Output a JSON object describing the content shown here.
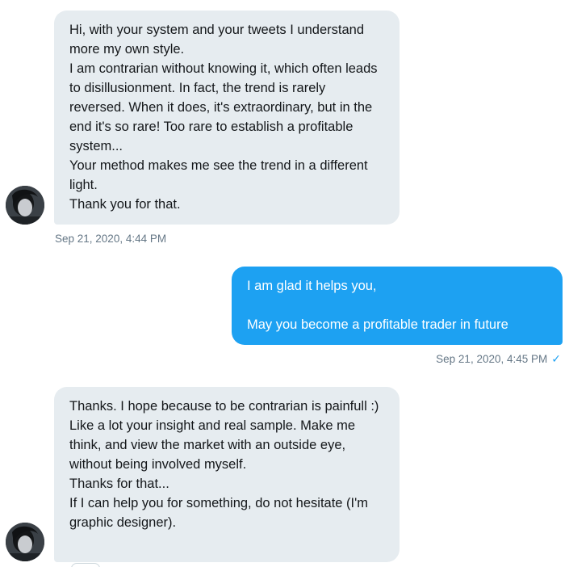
{
  "messages": [
    {
      "direction": "in",
      "text": "Hi, with your system and your tweets I understand more my own style.\nI am contrarian without knowing it, which often leads to disillusionment. In fact, the trend is rarely reversed. When it does, it's extraordinary, but in the end it's so rare! Too rare to establish a profitable system...\nYour method makes me see the trend in a different light.\nThank you for that.",
      "timestamp": "Sep 21, 2020, 4:44 PM"
    },
    {
      "direction": "out",
      "text": "I am glad it helps you,\n\nMay you become a profitable trader in future",
      "timestamp": "Sep 21, 2020, 4:45 PM",
      "status_icon": "checkmark-icon",
      "status_glyph": "✓"
    },
    {
      "direction": "in",
      "text": "Thanks. I hope because to be contrarian is painfull :)\nLike a lot your insight and real sample. Make me think, and view the market with an outside eye, without being involved myself.\nThanks for that...\nIf I can help you for something, do not hesitate (I'm graphic designer).",
      "timestamp": ""
    }
  ],
  "colors": {
    "incoming_bubble": "#e6ecf0",
    "outgoing_bubble": "#1da1f2",
    "timestamp_text": "#657786",
    "check_icon": "#1da1f2"
  }
}
